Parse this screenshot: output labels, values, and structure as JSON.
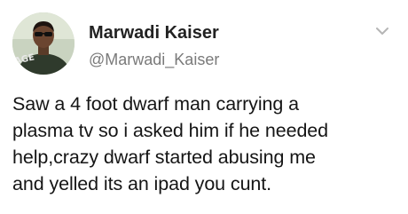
{
  "tweet": {
    "author": {
      "display_name": "Marwadi Kaiser",
      "handle": "@Marwadi_Kaiser",
      "avatar_text": "AGE"
    },
    "more_icon": "chevron-down-icon",
    "text_lines": [
      "Saw a 4 foot dwarf man carrying a",
      "plasma tv so i asked him if he needed",
      "help,crazy dwarf started abusing me",
      "and yelled its an ipad you cunt."
    ]
  },
  "colors": {
    "name": "#222222",
    "handle": "#7a7a7a",
    "text": "#151515",
    "caret": "#b5b5b5"
  }
}
